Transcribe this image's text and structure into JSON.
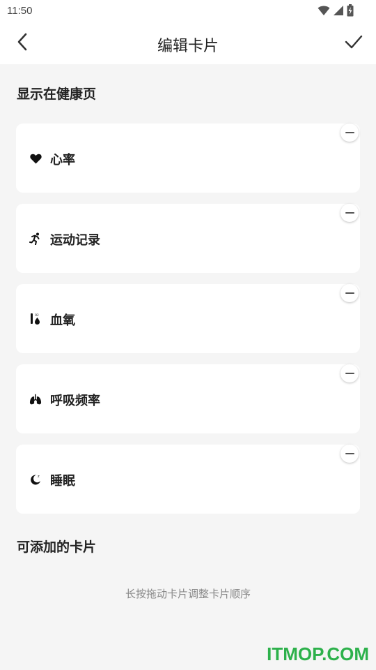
{
  "status_bar": {
    "time": "11:50",
    "icons": [
      "wifi-icon",
      "cellular-signal-icon",
      "battery-charging-icon"
    ]
  },
  "app_bar": {
    "title": "编辑卡片",
    "back_icon": "chevron-left-icon",
    "confirm_icon": "checkmark-icon"
  },
  "shown_section": {
    "title": "显示在健康页",
    "cards": [
      {
        "label": "心率",
        "icon": "heart-icon"
      },
      {
        "label": "运动记录",
        "icon": "running-icon"
      },
      {
        "label": "血氧",
        "icon": "blood-oxygen-icon"
      },
      {
        "label": "呼吸频率",
        "icon": "lungs-icon"
      },
      {
        "label": "睡眠",
        "icon": "moon-icon"
      }
    ]
  },
  "available_section": {
    "title": "可添加的卡片"
  },
  "hint": "长按拖动卡片调整卡片顺序",
  "watermark": "ITMOP.COM"
}
